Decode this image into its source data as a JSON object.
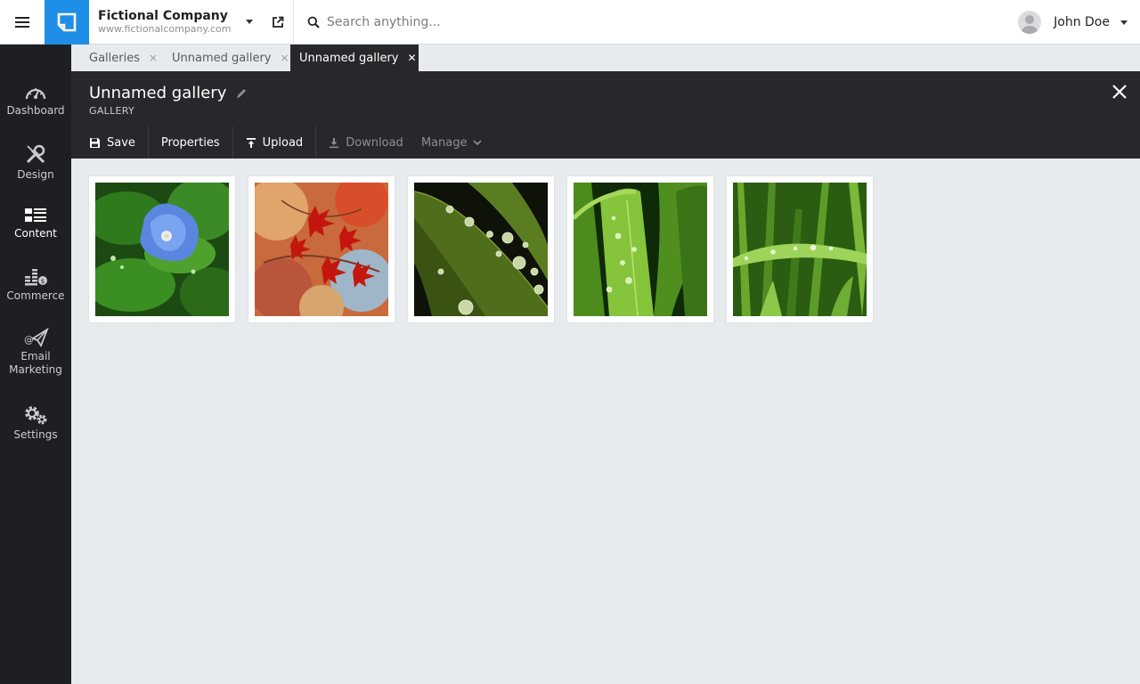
{
  "topbar": {
    "site_name": "Fictional Company",
    "site_url": "www.fictionalcompany.com",
    "search_placeholder": "Search anything...",
    "user_name": "John Doe"
  },
  "sidebar": {
    "items": [
      {
        "label": "Dashboard",
        "icon": "dashboard-gauge-icon"
      },
      {
        "label": "Design",
        "icon": "wrench-screwdriver-icon"
      },
      {
        "label": "Content",
        "icon": "content-list-icon",
        "active": true
      },
      {
        "label": "Commerce",
        "icon": "commerce-coins-icon"
      },
      {
        "label": "Email",
        "label2": "Marketing",
        "icon": "email-paperplane-icon"
      },
      {
        "label": "Settings",
        "icon": "gears-icon"
      }
    ]
  },
  "tabs": [
    {
      "label": "Galleries",
      "close": "×"
    },
    {
      "label": "Unnamed gallery",
      "close": "×"
    },
    {
      "label": "Unnamed gallery",
      "close": "✕",
      "active": true
    }
  ],
  "header": {
    "title": "Unnamed gallery",
    "subtitle": "GALLERY"
  },
  "toolbar": {
    "save": "Save",
    "properties": "Properties",
    "upload": "Upload",
    "download": "Download",
    "manage": "Manage"
  },
  "gallery": {
    "images": [
      {
        "subject": "blue flower with water drops"
      },
      {
        "subject": "red maple leaves"
      },
      {
        "subject": "leaf with water drops"
      },
      {
        "subject": "green leaves with dew"
      },
      {
        "subject": "grass blade with dew"
      }
    ]
  },
  "colors": {
    "accent": "#1f8ee6",
    "sidebar_bg": "#1e1f22",
    "header_bg": "#26282b",
    "content_bg": "#e8ebee"
  }
}
